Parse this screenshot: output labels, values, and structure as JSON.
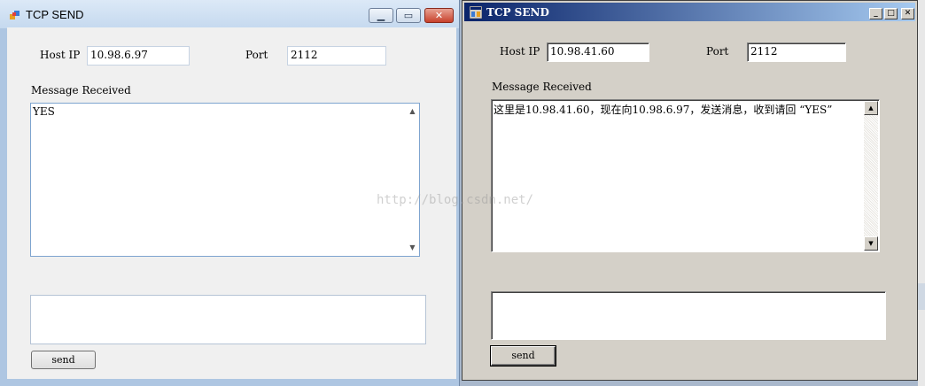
{
  "window1": {
    "title": "TCP SEND",
    "host_ip_label": "Host IP",
    "host_ip_value": "10.98.6.97",
    "port_label": "Port",
    "port_value": "2112",
    "message_received_label": "Message Received",
    "message_received_text": "YES",
    "send_input_value": "",
    "send_button_label": "send"
  },
  "window2": {
    "title": "TCP SEND",
    "host_ip_label": "Host IP",
    "host_ip_value": "10.98.41.60",
    "port_label": "Port",
    "port_value": "2112",
    "message_received_label": "Message Received",
    "message_received_text": "这里是10.98.41.60，现在向10.98.6.97，发送消息，收到请回 “YES”",
    "send_input_value": "",
    "send_button_label": "send"
  },
  "watermark": "http://blog.csdn.net/",
  "icons": {
    "window_icon": "app-window-icon",
    "minimize": "minimize-icon",
    "maximize": "maximize-icon",
    "close": "close-icon"
  },
  "colors": {
    "classic_titlebar_start": "#0a246a",
    "classic_titlebar_end": "#a6caf0",
    "win7_close": "#c8412c"
  }
}
